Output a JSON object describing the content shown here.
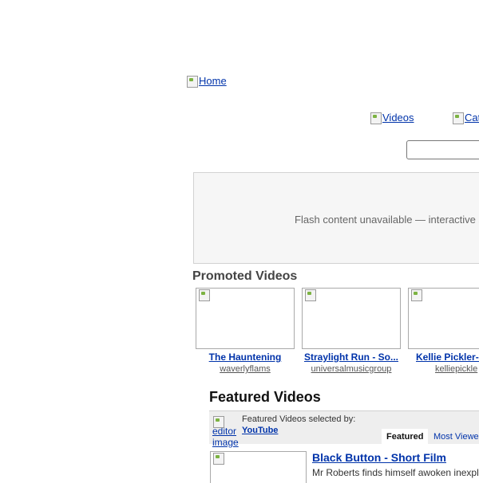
{
  "header": {
    "home_link": "Home",
    "nav": [
      {
        "label": "Videos"
      },
      {
        "label": "Cat"
      }
    ],
    "search": {
      "value": "",
      "placeholder": ""
    }
  },
  "flash": {
    "message": "Flash content unavailable — interactive shar"
  },
  "promoted": {
    "title": "Promoted Videos",
    "items": [
      {
        "title": "The Hauntening",
        "user": "waverlyflams"
      },
      {
        "title": "Straylight Run - So...",
        "user": "universalmusicgroup"
      },
      {
        "title": "Kellie Pickler-I",
        "user": "kelliepickle"
      }
    ]
  },
  "featured": {
    "title": "Featured Videos",
    "editor_image_alt": "editor image",
    "selected_by_label": "Featured Videos selected by:",
    "selected_by_link": "YouTube",
    "tabs": [
      {
        "label": "Featured",
        "active": true
      },
      {
        "label": "Most Viewe",
        "active": false
      }
    ],
    "video": {
      "title": "Black Button - Short Film",
      "description": "Mr Roberts finds himself awoken inexpl"
    }
  },
  "colors": {
    "link": "#0033aa",
    "panel_bg": "#eeeeee",
    "flash_bg": "#f6f6f6"
  }
}
